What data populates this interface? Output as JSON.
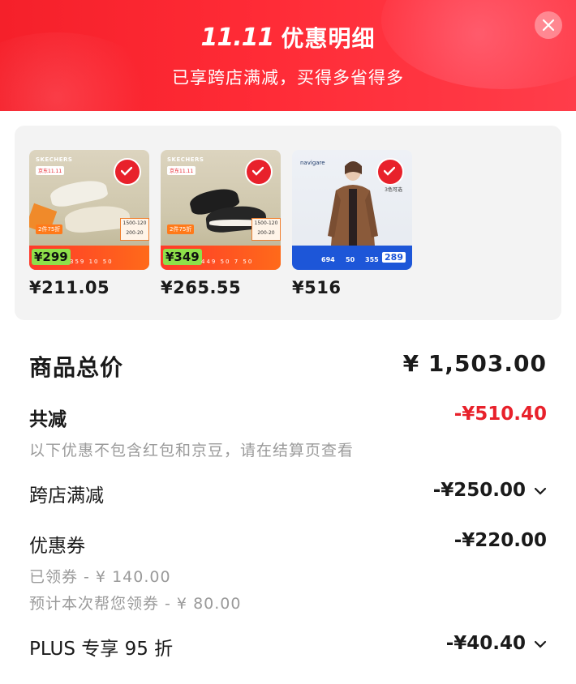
{
  "header": {
    "logo": "11.11",
    "title": "优惠明细",
    "subtitle": "已享跨店满减，买得多省得多",
    "accent": "#f5202a"
  },
  "products": [
    {
      "brand": "SKECHERS",
      "jd_tag": "京东11.11",
      "promo_tag": "2件75折",
      "manjian": [
        "1500-120",
        "200-20"
      ],
      "list_price": "¥299",
      "strip_numbers": "359  10  50",
      "price": "¥211.05",
      "selected": true
    },
    {
      "brand": "SKECHERS",
      "jd_tag": "京东11.11",
      "promo_tag": "2件75折",
      "manjian": [
        "1500-120",
        "200-20"
      ],
      "list_price": "¥349",
      "strip_numbers": "449  50  7  50",
      "price": "¥265.55",
      "selected": true
    },
    {
      "brand": "navigare",
      "more": "3色可选",
      "strip_numbers": [
        "694",
        "50",
        "355"
      ],
      "list_price": "289",
      "price": "¥516",
      "selected": true
    }
  ],
  "summary": {
    "total_label": "商品总价",
    "total_value": "¥ 1,503.00",
    "reduce_label": "共减",
    "reduce_value": "-¥510.40",
    "reduce_note": "以下优惠不包含红包和京豆，请在结算页查看",
    "cross_store_label": "跨店满减",
    "cross_store_value": "-¥250.00",
    "coupon_label": "优惠券",
    "coupon_value": "-¥220.00",
    "coupon_claimed": "已领券 - ¥ 140.00",
    "coupon_to_claim": "预计本次帮您领券 - ¥ 80.00",
    "plus_label": "PLUS 专享 95 折",
    "plus_value": "-¥40.40"
  },
  "colors": {
    "red": "#e8212b",
    "grey_text": "#9a9a9a",
    "panel": "#f3f3f3"
  },
  "icons": [
    "close-icon",
    "check-icon",
    "chevron-down-icon"
  ]
}
